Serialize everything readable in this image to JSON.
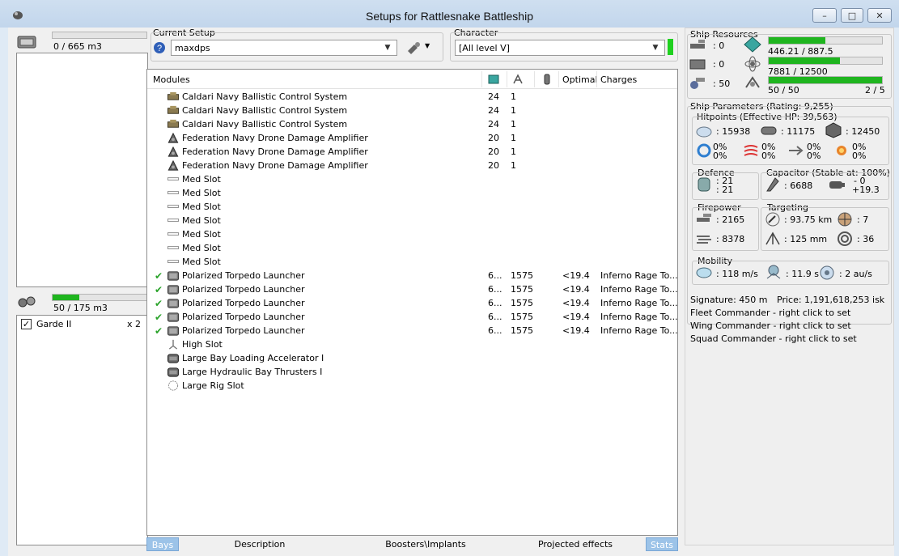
{
  "window": {
    "title": "Setups for Rattlesnake Battleship"
  },
  "cargo": {
    "label": "0 / 665 m3",
    "fill": 0.0
  },
  "drones": {
    "label": "50 / 175 m3",
    "fill": 0.286,
    "items": [
      {
        "name": "Garde II",
        "qty": "x 2",
        "checked": true
      }
    ]
  },
  "setup": {
    "group_label": "Current Setup",
    "selected": "maxdps"
  },
  "character": {
    "group_label": "Character",
    "selected": "[All level V]"
  },
  "modules": {
    "columns": [
      "Modules",
      "Optimal",
      "Charges"
    ],
    "rows": [
      {
        "name": "Caldari Navy Ballistic Control System",
        "cpu": "24",
        "pg": "1",
        "optimal": "",
        "charge": "",
        "check": false,
        "icon": "bcs-icon"
      },
      {
        "name": "Caldari Navy Ballistic Control System",
        "cpu": "24",
        "pg": "1",
        "optimal": "",
        "charge": "",
        "check": false,
        "icon": "bcs-icon"
      },
      {
        "name": "Caldari Navy Ballistic Control System",
        "cpu": "24",
        "pg": "1",
        "optimal": "",
        "charge": "",
        "check": false,
        "icon": "bcs-icon"
      },
      {
        "name": "Federation Navy Drone Damage Amplifier",
        "cpu": "20",
        "pg": "1",
        "optimal": "",
        "charge": "",
        "check": false,
        "icon": "dda-icon"
      },
      {
        "name": "Federation Navy Drone Damage Amplifier",
        "cpu": "20",
        "pg": "1",
        "optimal": "",
        "charge": "",
        "check": false,
        "icon": "dda-icon"
      },
      {
        "name": "Federation Navy Drone Damage Amplifier",
        "cpu": "20",
        "pg": "1",
        "optimal": "",
        "charge": "",
        "check": false,
        "icon": "dda-icon"
      },
      {
        "name": "Med Slot",
        "cpu": "",
        "pg": "",
        "optimal": "",
        "charge": "",
        "check": false,
        "icon": "empty-med-slot-icon"
      },
      {
        "name": "Med Slot",
        "cpu": "",
        "pg": "",
        "optimal": "",
        "charge": "",
        "check": false,
        "icon": "empty-med-slot-icon"
      },
      {
        "name": "Med Slot",
        "cpu": "",
        "pg": "",
        "optimal": "",
        "charge": "",
        "check": false,
        "icon": "empty-med-slot-icon"
      },
      {
        "name": "Med Slot",
        "cpu": "",
        "pg": "",
        "optimal": "",
        "charge": "",
        "check": false,
        "icon": "empty-med-slot-icon"
      },
      {
        "name": "Med Slot",
        "cpu": "",
        "pg": "",
        "optimal": "",
        "charge": "",
        "check": false,
        "icon": "empty-med-slot-icon"
      },
      {
        "name": "Med Slot",
        "cpu": "",
        "pg": "",
        "optimal": "",
        "charge": "",
        "check": false,
        "icon": "empty-med-slot-icon"
      },
      {
        "name": "Med Slot",
        "cpu": "",
        "pg": "",
        "optimal": "",
        "charge": "",
        "check": false,
        "icon": "empty-med-slot-icon"
      },
      {
        "name": "Polarized Torpedo Launcher",
        "cpu": "6...",
        "pg": "1575",
        "optimal": "<19.4",
        "charge": "Inferno Rage To...",
        "check": true,
        "icon": "torpedo-launcher-icon"
      },
      {
        "name": "Polarized Torpedo Launcher",
        "cpu": "6...",
        "pg": "1575",
        "optimal": "<19.4",
        "charge": "Inferno Rage To...",
        "check": true,
        "icon": "torpedo-launcher-icon"
      },
      {
        "name": "Polarized Torpedo Launcher",
        "cpu": "6...",
        "pg": "1575",
        "optimal": "<19.4",
        "charge": "Inferno Rage To...",
        "check": true,
        "icon": "torpedo-launcher-icon"
      },
      {
        "name": "Polarized Torpedo Launcher",
        "cpu": "6...",
        "pg": "1575",
        "optimal": "<19.4",
        "charge": "Inferno Rage To...",
        "check": true,
        "icon": "torpedo-launcher-icon"
      },
      {
        "name": "Polarized Torpedo Launcher",
        "cpu": "6...",
        "pg": "1575",
        "optimal": "<19.4",
        "charge": "Inferno Rage To...",
        "check": true,
        "icon": "torpedo-launcher-icon"
      },
      {
        "name": "High Slot",
        "cpu": "",
        "pg": "",
        "optimal": "",
        "charge": "",
        "check": false,
        "icon": "empty-high-slot-icon"
      },
      {
        "name": "Large Bay Loading Accelerator I",
        "cpu": "",
        "pg": "",
        "optimal": "",
        "charge": "",
        "check": false,
        "icon": "rig-icon"
      },
      {
        "name": "Large Hydraulic Bay Thrusters I",
        "cpu": "",
        "pg": "",
        "optimal": "",
        "charge": "",
        "check": false,
        "icon": "rig-icon"
      },
      {
        "name": "Large Rig Slot",
        "cpu": "",
        "pg": "",
        "optimal": "",
        "charge": "",
        "check": false,
        "icon": "empty-rig-slot-icon"
      }
    ]
  },
  "tabs": [
    "Bays",
    "Description",
    "Boosters\\Implants",
    "Projected effects",
    "Stats"
  ],
  "resources": {
    "title": "Ship Resources",
    "turret_hardpoints": ": 0",
    "launcher_hardpoints": ": 0",
    "calibration": ": 50",
    "cpu_text": "446.21 / 887.5",
    "cpu_fill": 0.503,
    "pg_text": "7881 / 12500",
    "pg_fill": 0.63,
    "drone_bw_text": "50 / 50",
    "drones_active": "2 / 5",
    "drone_bw_fill": 1.0
  },
  "params": {
    "title": "Ship Parameters (Rating: 9,255)",
    "hitpoints_title": "Hitpoints (Effective HP: 39,563)",
    "shield_hp": ": 15938",
    "armor_hp": ": 11175",
    "structure_hp": ": 12450",
    "resists": [
      [
        "0%",
        "0%"
      ],
      [
        "0%",
        "0%"
      ],
      [
        "0%",
        "0%"
      ],
      [
        "0%",
        "0%"
      ]
    ],
    "defence_title": "Defence",
    "defence_a": ": 21",
    "defence_b": ": 21",
    "capacitor_title": "Capacitor (Stable at: 100%)",
    "capacitor_value": ": 6688",
    "cap_delta_a": "- 0",
    "cap_delta_b": "+19.3",
    "firepower_title": "Firepower",
    "dps": ": 2165",
    "volley": ": 8378",
    "targeting_title": "Targeting",
    "target_range": ": 93.75 km",
    "max_targets": ": 7",
    "scan_res": ": 125 mm",
    "sensor_strength": ": 36",
    "mobility_title": "Mobility",
    "max_velocity": ": 118 m/s",
    "align_time": ": 11.9 s",
    "warp_speed": ": 2 au/s",
    "signature": "Signature: 450 m",
    "price": "Price: 1,191,618,253 isk",
    "fleet_commander": "Fleet Commander - right click to set",
    "wing_commander": "Wing Commander - right click to set",
    "squad_commander": "Squad Commander - right click to set"
  }
}
